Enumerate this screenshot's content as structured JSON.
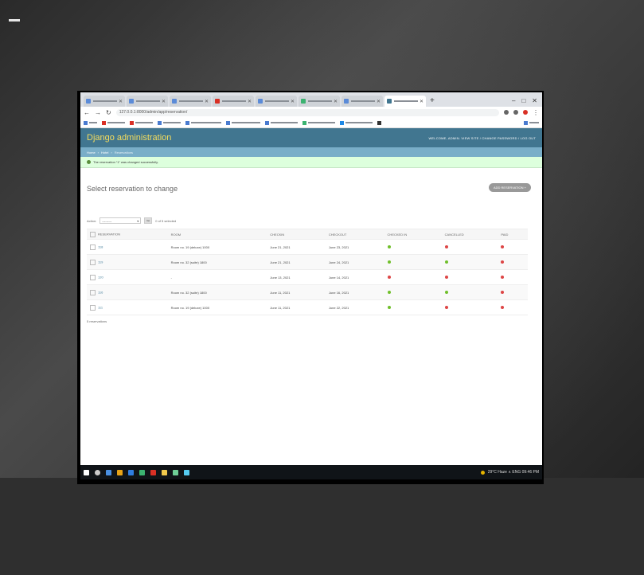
{
  "browser": {
    "tab_count": 10,
    "address": "127.0.0.1:8000/admin/app/reservation/"
  },
  "admin": {
    "brand": "Django administration",
    "user_tools": "WELCOME, ADMIN. VIEW SITE / CHANGE PASSWORD / LOG OUT",
    "breadcrumbs": [
      "Home",
      "›",
      "Hotel",
      "›",
      "Reservations"
    ],
    "message": "The reservation “1” was changed successfully.",
    "page_title": "Select reservation to change",
    "add_button": "ADD RESERVATION +",
    "actions": {
      "label": "Action:",
      "select_value": "---------",
      "go": "Go",
      "selected": "0 of 5 selected"
    },
    "table": {
      "columns": [
        "RESERVATION",
        "ROOM",
        "CHECKIN",
        "CHECKOUT",
        "CHECKED IN",
        "CANCELLED",
        "PAID"
      ],
      "rows": [
        {
          "reservation": "118",
          "room": "Room no. 19 (deluxe) 1000",
          "checkin": "June 21, 2021",
          "checkout": "June 23, 2021",
          "checkedin": "yes",
          "cancelled": "no",
          "paid": "no"
        },
        {
          "reservation": "119",
          "room": "Room no. 32 (suite) 1800",
          "checkin": "June 21, 2021",
          "checkout": "June 24, 2021",
          "checkedin": "yes",
          "cancelled": "yes",
          "paid": "no"
        },
        {
          "reservation": "120",
          "room": "-",
          "checkin": "June 13, 2021",
          "checkout": "June 14, 2021",
          "checkedin": "no",
          "cancelled": "no",
          "paid": "no"
        },
        {
          "reservation": "116",
          "room": "Room no. 32 (suite) 1800",
          "checkin": "June 11, 2021",
          "checkout": "June 16, 2021",
          "checkedin": "yes",
          "cancelled": "yes",
          "paid": "no"
        },
        {
          "reservation": "111",
          "room": "Room no. 19 (deluxe) 1000",
          "checkin": "June 11, 2021",
          "checkout": "June 22, 2021",
          "checkedin": "yes",
          "cancelled": "no",
          "paid": "no"
        }
      ]
    },
    "paginator": "5 reservations"
  },
  "taskbar": {
    "icon_colors": [
      "#ffffff",
      "#cccccc",
      "#4a90e2",
      "#e8a317",
      "#2f7de1",
      "#3cb371",
      "#d93025",
      "#f2c94c",
      "#6fcf97",
      "#56ccf2"
    ],
    "tray_text": "29°C Haze ∧ ENG 09:46 PM"
  },
  "colors": {
    "header": "#417690",
    "brand_text": "#f5dd5d",
    "breadcrumbs": "#79aec8",
    "success_bg": "#ddffdd",
    "yes": "#70bf2b",
    "no": "#dd4646"
  }
}
